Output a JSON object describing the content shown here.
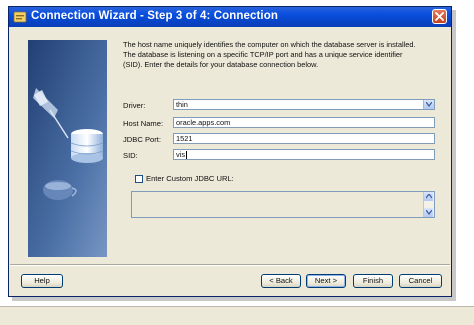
{
  "window": {
    "title": "Connection Wizard - Step 3 of 4: Connection"
  },
  "description": "The host name uniquely identifies the computer on which the database server is installed.  The database is listening on a specific TCP/IP port and has a unique service identifier (SID).  Enter the details for your database connection below.",
  "form": {
    "driver": {
      "label": "Driver:",
      "value": "thin"
    },
    "host": {
      "label": "Host Name:",
      "value": "oracle.apps.com"
    },
    "port": {
      "label": "JDBC Port:",
      "value": "1521"
    },
    "sid": {
      "label": "SID:",
      "value": "vis"
    },
    "custom_url": {
      "label": "Enter Custom JDBC URL:",
      "checked": false,
      "value": ""
    }
  },
  "buttons": {
    "help": "Help",
    "back": "< Back",
    "next": "Next >",
    "finish": "Finish",
    "cancel": "Cancel"
  },
  "colors": {
    "titlebar": "#0a4fe0",
    "dialog_bg": "#ece9d8",
    "field_border": "#7f9db9",
    "art_blue": "#2a4d86"
  },
  "icons": [
    "app-icon",
    "close-icon",
    "chevron-down-icon",
    "scroll-up-icon",
    "scroll-down-icon"
  ]
}
